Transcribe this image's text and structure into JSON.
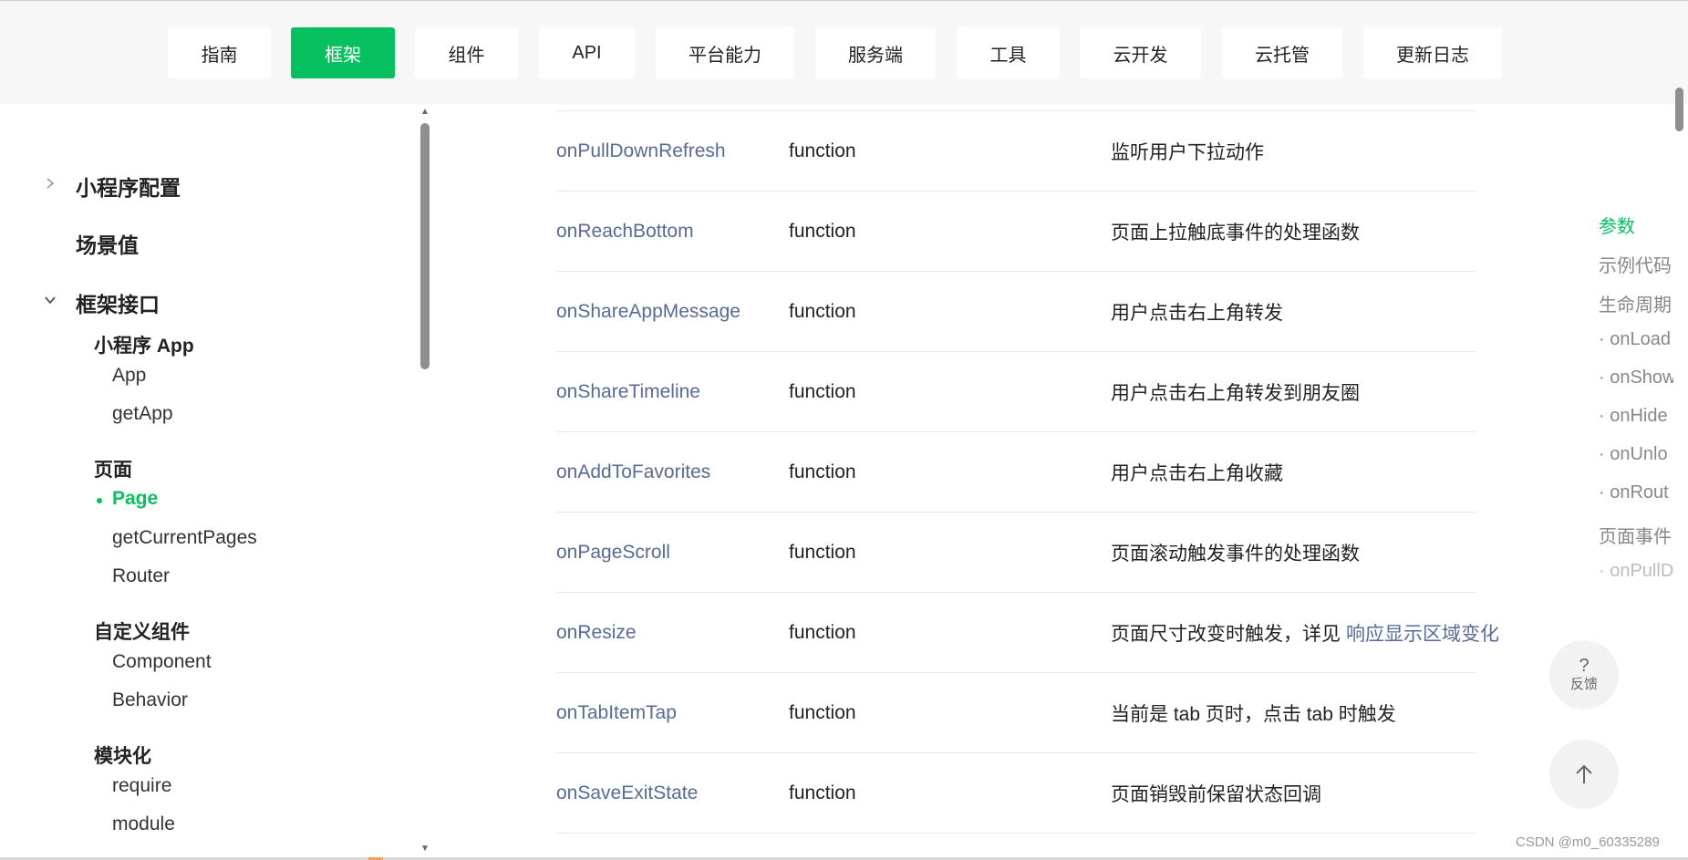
{
  "nav": {
    "tabs": [
      {
        "label": "指南"
      },
      {
        "label": "框架"
      },
      {
        "label": "组件"
      },
      {
        "label": "API"
      },
      {
        "label": "平台能力"
      },
      {
        "label": "服务端"
      },
      {
        "label": "工具"
      },
      {
        "label": "云开发"
      },
      {
        "label": "云托管"
      },
      {
        "label": "更新日志"
      }
    ],
    "active": "框架"
  },
  "sidebar": {
    "groups": [
      {
        "label": "小程序配置",
        "expanded": false
      },
      {
        "label": "场景值"
      },
      {
        "label": "框架接口",
        "expanded": true
      }
    ],
    "sections": [
      {
        "label": "小程序 App",
        "items": [
          "App",
          "getApp"
        ]
      },
      {
        "label": "页面",
        "items": [
          "Page",
          "getCurrentPages",
          "Router"
        ]
      },
      {
        "label": "自定义组件",
        "items": [
          "Component",
          "Behavior"
        ]
      },
      {
        "label": "模块化",
        "items": [
          "require",
          "module"
        ]
      }
    ],
    "active_item": "Page"
  },
  "table": {
    "rows": [
      {
        "name": "onPullDownRefresh",
        "type": "function",
        "desc": "监听用户下拉动作"
      },
      {
        "name": "onReachBottom",
        "type": "function",
        "desc": "页面上拉触底事件的处理函数"
      },
      {
        "name": "onShareAppMessage",
        "type": "function",
        "desc": "用户点击右上角转发"
      },
      {
        "name": "onShareTimeline",
        "type": "function",
        "desc": "用户点击右上角转发到朋友圈"
      },
      {
        "name": "onAddToFavorites",
        "type": "function",
        "desc": "用户点击右上角收藏"
      },
      {
        "name": "onPageScroll",
        "type": "function",
        "desc": "页面滚动触发事件的处理函数"
      },
      {
        "name": "onResize",
        "type": "function",
        "desc": "页面尺寸改变时触发，详见",
        "link": "响应显示区域变化"
      },
      {
        "name": "onTabItemTap",
        "type": "function",
        "desc": "当前是 tab 页时，点击 tab 时触发"
      },
      {
        "name": "onSaveExitState",
        "type": "function",
        "desc": "页面销毁前保留状态回调"
      }
    ]
  },
  "toc": {
    "items": [
      {
        "label": "参数",
        "active": true
      },
      {
        "label": "示例代码"
      },
      {
        "label": "生命周期"
      },
      {
        "label": "· onLoad"
      },
      {
        "label": "· onShow"
      },
      {
        "label": "· onHide"
      },
      {
        "label": "· onUnlo"
      },
      {
        "label": "· onRout"
      },
      {
        "label": "页面事件"
      },
      {
        "label": "· onPullD"
      }
    ]
  },
  "floating": {
    "feedback_icon": "?",
    "feedback_label": "反馈",
    "back_to_top_icon": "arrow-up-icon"
  },
  "watermark": "CSDN @m0_60335289",
  "colors": {
    "accent": "#07c160",
    "link": "#576b95"
  }
}
